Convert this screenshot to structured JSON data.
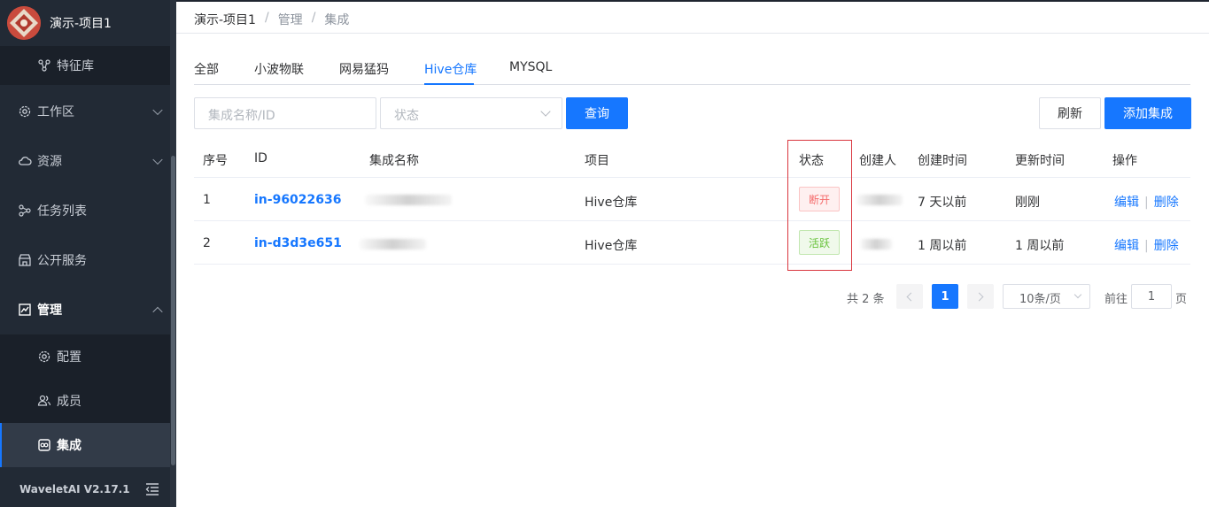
{
  "sidebar": {
    "project_name": "演示-项目1",
    "feature_store": "特征库",
    "workspace": "工作区",
    "resources": "资源",
    "task_list": "任务列表",
    "public_services": "公开服务",
    "management": "管理",
    "config": "配置",
    "members": "成员",
    "integrations": "集成",
    "version": "WaveletAI V2.17.1"
  },
  "breadcrumb": [
    "演示-项目1",
    "管理",
    "集成"
  ],
  "tabs": [
    "全部",
    "小波物联",
    "网易猛犸",
    "Hive仓库",
    "MYSQL"
  ],
  "selected_tab": "Hive仓库",
  "filters": {
    "name_placeholder": "集成名称/ID",
    "status_placeholder": "状态",
    "query_button": "查询",
    "refresh_button": "刷新",
    "add_button": "添加集成"
  },
  "table": {
    "columns": [
      "序号",
      "ID",
      "集成名称",
      "项目",
      "状态",
      "创建人",
      "创建时间",
      "更新时间",
      "操作"
    ],
    "rows": [
      {
        "index": "1",
        "id": "in-96022636",
        "project": "Hive仓库",
        "status": "断开",
        "status_type": "off",
        "created": "7 天以前",
        "updated": "刚刚",
        "edit": "编辑",
        "delete": "删除"
      },
      {
        "index": "2",
        "id": "in-d3d3e651",
        "project": "Hive仓库",
        "status": "活跃",
        "status_type": "on",
        "created": "1 周以前",
        "updated": "1 周以前",
        "edit": "编辑",
        "delete": "删除"
      }
    ]
  },
  "pagination": {
    "total_text": "共 2 条",
    "current_page": "1",
    "page_size": "10条/页",
    "goto_label": "前往",
    "goto_value": "1",
    "page_suffix": "页"
  },
  "colors": {
    "primary": "#1677ff",
    "sidebar_bg": "#222a35",
    "status_off": "#f56c6c",
    "status_on": "#67c23a",
    "highlight_box": "#d9363e"
  }
}
